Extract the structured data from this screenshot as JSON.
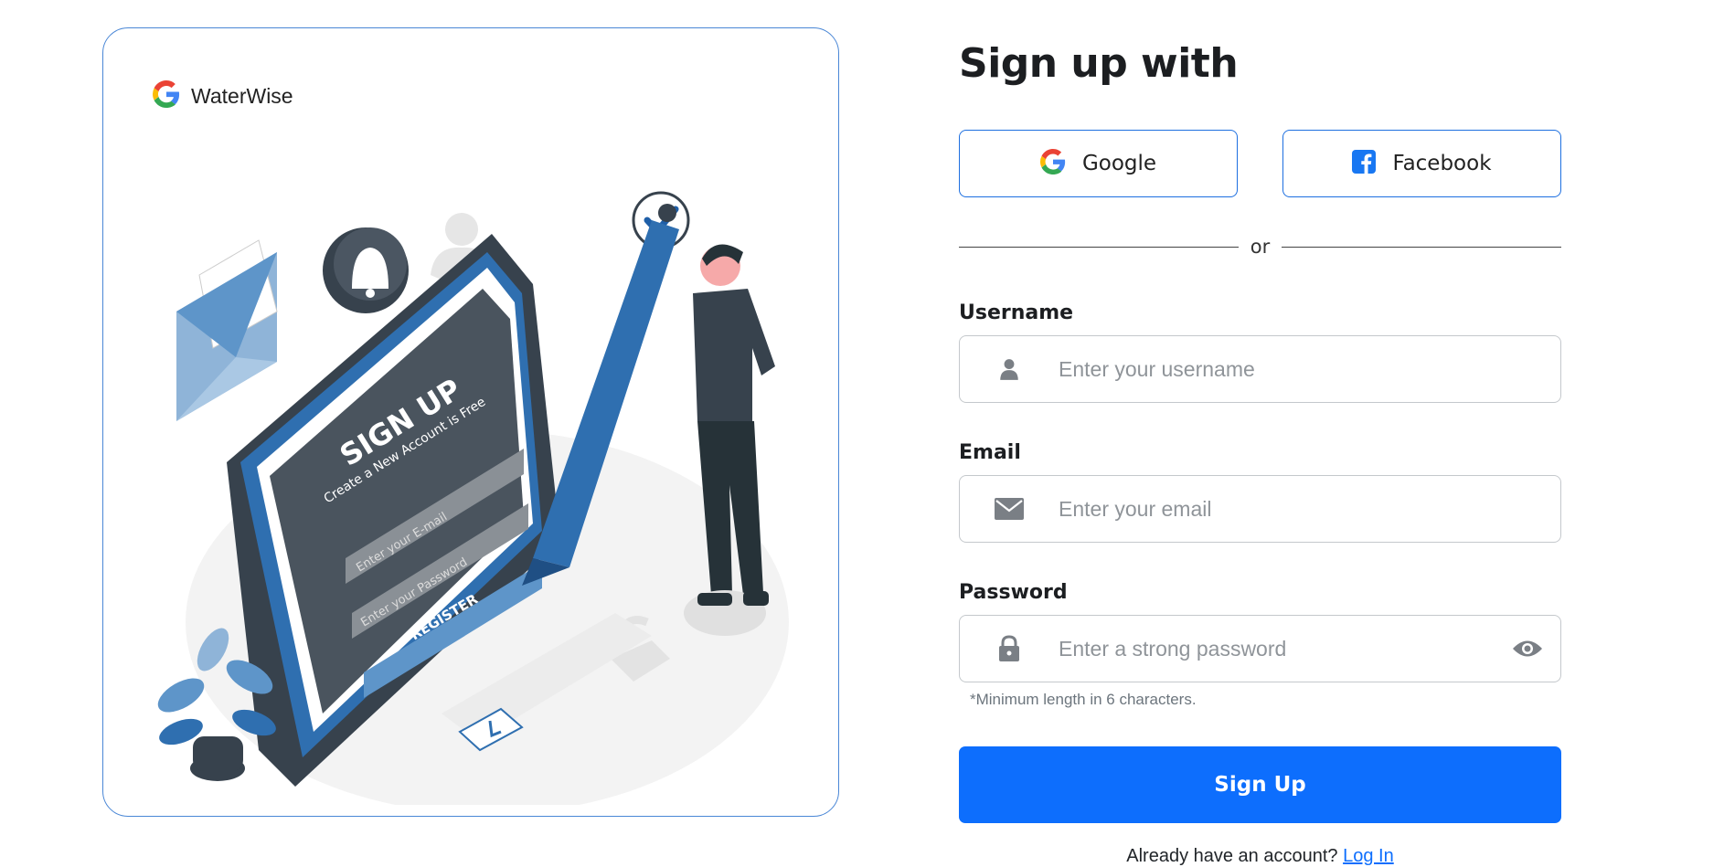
{
  "brand": {
    "name": "WaterWise",
    "logo": "google-g-logo"
  },
  "illustration": {
    "sign_up_title": "SIGN UP",
    "sign_up_subtitle": "Create a New Account is Free",
    "email_placeholder": "Enter your E-mail",
    "password_placeholder": "Enter your Password",
    "register_label": "REGISTER"
  },
  "form": {
    "heading": "Sign up with",
    "social": {
      "google_label": "Google",
      "facebook_label": "Facebook"
    },
    "divider_text": "or",
    "username": {
      "label": "Username",
      "placeholder": "Enter your username",
      "value": ""
    },
    "email": {
      "label": "Email",
      "placeholder": "Enter your email",
      "value": ""
    },
    "password": {
      "label": "Password",
      "placeholder": "Enter a strong password",
      "value": ""
    },
    "password_hint": "*Minimum length in 6 characters.",
    "submit_label": "Sign Up",
    "login_prompt": "Already have an account?",
    "login_link": "Log In"
  },
  "colors": {
    "primary": "#0d6efd",
    "card_border": "#4a87d6",
    "illustration_blue": "#2f6fb0",
    "illustration_dark": "#37424d"
  }
}
